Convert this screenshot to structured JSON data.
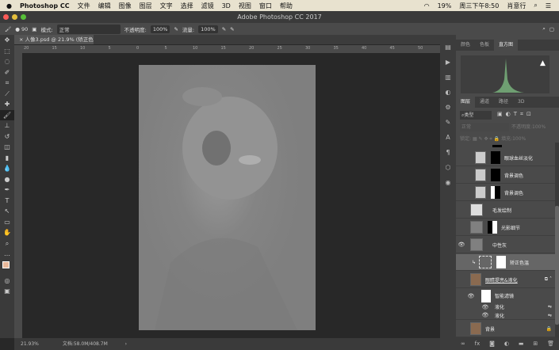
{
  "menubar": {
    "apple": "",
    "items": [
      "Photoshop CC",
      "文件",
      "编辑",
      "图像",
      "图层",
      "文字",
      "选择",
      "滤镜",
      "3D",
      "视图",
      "窗口",
      "帮助"
    ],
    "battery": "19%",
    "clock": "周三下午8:50",
    "user": "肖意行"
  },
  "window": {
    "title": "Adobe Photoshop CC 2017"
  },
  "options": {
    "brush_size": "90",
    "mode_label": "模式:",
    "mode_value": "正常",
    "opacity_label": "不透明度:",
    "opacity_value": "100%",
    "flow_label": "流量:",
    "flow_value": "100%"
  },
  "document_tab": {
    "label": "人像3.psd @ 21.9% (矫正色温, RGB/8) *"
  },
  "ruler": {
    "ticks": [
      "20",
      "15",
      "10",
      "5",
      "0",
      "5",
      "10",
      "15",
      "20",
      "25",
      "30",
      "35",
      "40",
      "45",
      "50"
    ]
  },
  "status": {
    "zoom": "21.93%",
    "doc": "文档:58.0M/408.7M"
  },
  "panels": {
    "top_tabs": [
      "颜色",
      "色板",
      "直方图"
    ],
    "top_active": "直方图",
    "layer_tabs": [
      "图层",
      "通道",
      "路径",
      "3D"
    ],
    "filter_kind": "类型",
    "blend_mode": "正常",
    "opacity_label": "不透明度:",
    "opacity_value": "100%",
    "lock_label": "锁定:",
    "fill_label": "填充:",
    "fill_value": "100%"
  },
  "layers": [
    {
      "name": "眼球血丝淡化",
      "visible": false
    },
    {
      "name": "背景调色",
      "visible": false
    },
    {
      "name": "背景调色",
      "visible": false
    },
    {
      "name": "毛发绘制",
      "visible": false
    },
    {
      "name": "光影细节",
      "visible": false
    },
    {
      "name": "中性灰",
      "visible": true
    },
    {
      "name": "矫正色温",
      "visible": false,
      "selected": true
    },
    {
      "name": "眼睛提亮&液化",
      "visible": false
    },
    {
      "name": "智能滤镜",
      "visible": true
    },
    {
      "name": "液化",
      "visible": true
    },
    {
      "name": "液化",
      "visible": true
    },
    {
      "name": "背景",
      "visible": false
    }
  ],
  "colors": {
    "menubar": "#e8e2cf",
    "workspace": "#282828",
    "panel": "#4a4a4a",
    "histogram": "#6f9f72",
    "foreground": "#e8b89a"
  }
}
